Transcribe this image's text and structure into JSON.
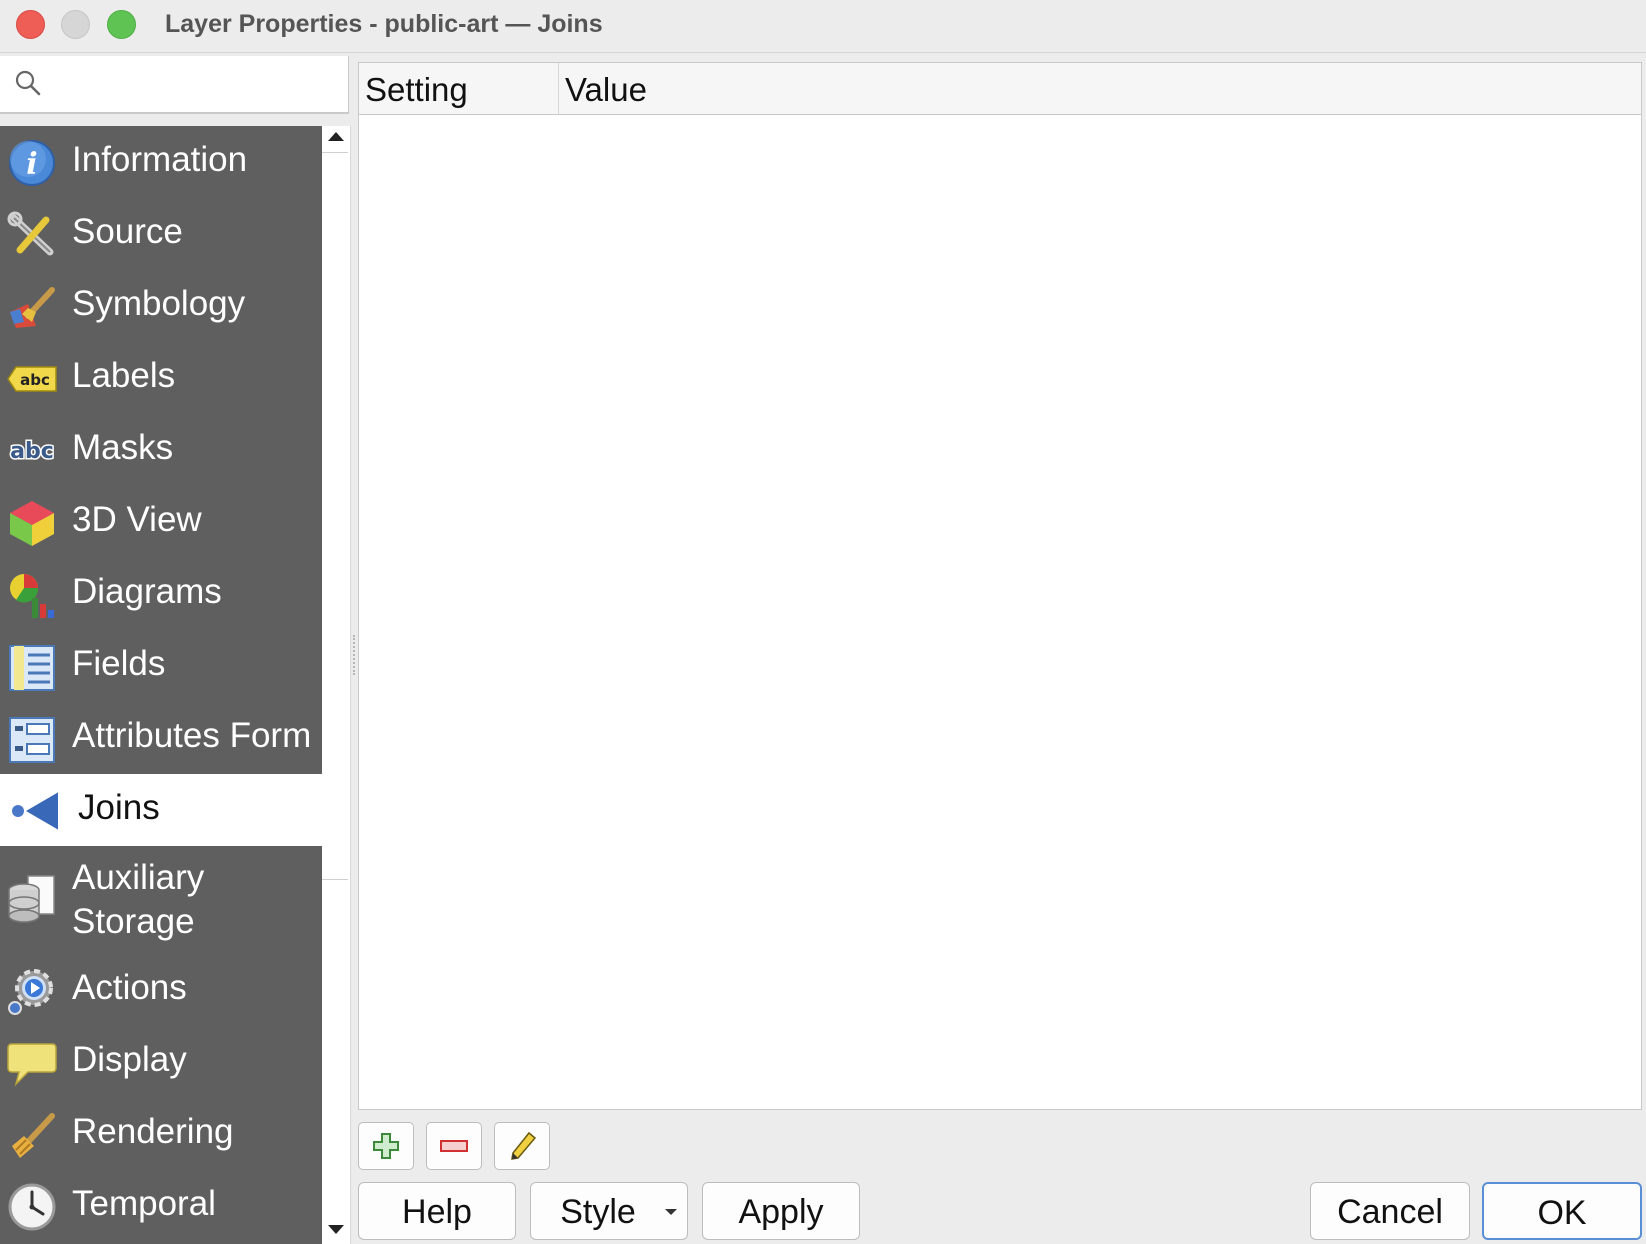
{
  "window": {
    "title": "Layer Properties - public-art — Joins"
  },
  "sidebar": {
    "search": {
      "value": "",
      "placeholder": ""
    },
    "items": [
      {
        "label": "Information",
        "icon": "information-icon"
      },
      {
        "label": "Source",
        "icon": "source-tools-icon"
      },
      {
        "label": "Symbology",
        "icon": "symbology-brush-icon"
      },
      {
        "label": "Labels",
        "icon": "labels-abc-icon"
      },
      {
        "label": "Masks",
        "icon": "masks-abc-icon"
      },
      {
        "label": "3D View",
        "icon": "cube-icon"
      },
      {
        "label": "Diagrams",
        "icon": "diagrams-icon"
      },
      {
        "label": "Fields",
        "icon": "fields-icon"
      },
      {
        "label": "Attributes Form",
        "icon": "attributes-form-icon"
      },
      {
        "label": "Joins",
        "icon": "joins-icon",
        "selected": true
      },
      {
        "label": "Auxiliary Storage",
        "icon": "database-icon"
      },
      {
        "label": "Actions",
        "icon": "actions-gear-icon"
      },
      {
        "label": "Display",
        "icon": "speech-bubble-icon"
      },
      {
        "label": "Rendering",
        "icon": "rendering-brush-icon"
      },
      {
        "label": "Temporal",
        "icon": "clock-icon"
      }
    ]
  },
  "joins_table": {
    "columns": [
      "Setting",
      "Value"
    ],
    "rows": []
  },
  "toolbar": {
    "add": "add-join-icon",
    "remove": "remove-join-icon",
    "edit": "edit-join-icon"
  },
  "buttons": {
    "help": "Help",
    "style": "Style",
    "apply": "Apply",
    "cancel": "Cancel",
    "ok": "OK"
  },
  "colors": {
    "sidebar_bg": "#5f5f5f",
    "selected_bg": "#ffffff",
    "ok_border": "#5a8fd6"
  }
}
